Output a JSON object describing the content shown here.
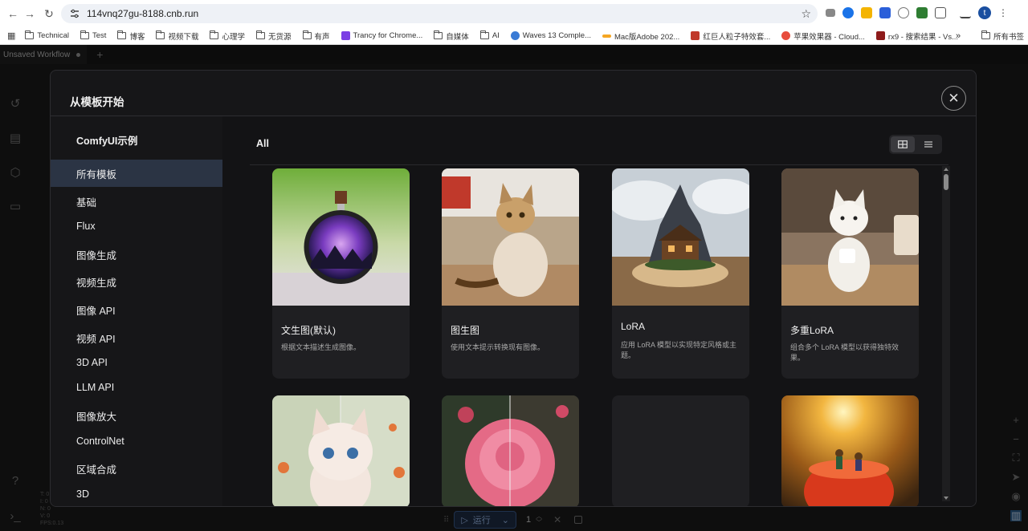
{
  "browser": {
    "url": "114vnq27gu-8188.cnb.run",
    "profile_initial": "t",
    "bookmarks": [
      "Technical",
      "Test",
      "博客",
      "视频下载",
      "心理学",
      "无货源",
      "有声",
      "Trancy for Chrome...",
      "自媒体",
      "AI",
      "Waves 13 Comple...",
      "Mac版Adobe 202...",
      "红巨人粒子特效套...",
      "苹果效果器 - Cloud...",
      "rx9 - 搜索结果 - Vs..."
    ],
    "all_bookmarks": "所有书签",
    "overflow": "»"
  },
  "app": {
    "workflow_tab": "Unsaved Workflow",
    "run_label": "运行",
    "batch_count": "1",
    "stats": [
      "T: 0",
      "I: 0",
      "N: 0",
      "V: 0",
      "FPS:0.13"
    ]
  },
  "dialog": {
    "title": "从模板开始",
    "sidebar": {
      "heading": "ComfyUI示例",
      "items": [
        "所有模板",
        "基础",
        "Flux",
        "图像生成",
        "视频生成",
        "图像 API",
        "视频 API",
        "3D API",
        "LLM API",
        "图像放大",
        "ControlNet",
        "区域合成",
        "3D"
      ]
    },
    "content_title": "All",
    "cards": [
      {
        "title": "文生图(默认)",
        "desc": "根据文本描述生成图像。"
      },
      {
        "title": "图生图",
        "desc": "使用文本提示转换现有图像。"
      },
      {
        "title": "LoRA",
        "desc": "应用 LoRA 模型以实现特定风格或主题。"
      },
      {
        "title": "多重LoRA",
        "desc": "组合多个 LoRA 模型以获得独特效果。"
      }
    ]
  },
  "colors": {
    "active_item_bg": "#2b3444",
    "dialog_bg": "#161618",
    "card_bg": "#1f1f22"
  }
}
